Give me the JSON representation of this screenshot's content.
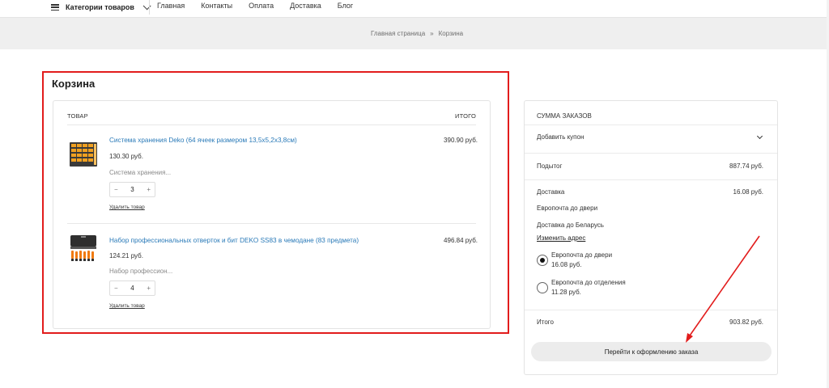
{
  "nav": {
    "categories_label": "Категории товаров",
    "links": [
      "Главная",
      "Контакты",
      "Оплата",
      "Доставка",
      "Блог"
    ]
  },
  "breadcrumb": {
    "home": "Главная страница",
    "separator": "»",
    "current": "Корзина"
  },
  "cart": {
    "title": "Корзина",
    "col_product": "ТОВАР",
    "col_total": "ИТОГО",
    "items": [
      {
        "name": "Система хранения Deko (64 ячеек размером 13,5х5,2х3,8см)",
        "price": "130.30 руб.",
        "subtitle": "Система хранения...",
        "qty": "3",
        "remove_label": "Удалить товар",
        "total": "390.90 руб."
      },
      {
        "name": "Набор профессиональных отверток и бит DEKO SS83 в чемодане (83 предмета)",
        "price": "124.21 руб.",
        "subtitle": "Набор профессион...",
        "qty": "4",
        "remove_label": "Удалить товар",
        "total": "496.84 руб."
      }
    ],
    "minus_symbol": "−",
    "plus_symbol": "+"
  },
  "totals": {
    "title": "СУММА ЗАКАЗОВ",
    "coupon_label": "Добавить купон",
    "subtotal_label": "Подытог",
    "subtotal_value": "887.74 руб.",
    "shipping_label": "Доставка",
    "shipping_value": "16.08 руб.",
    "shipping_method": "Европочта до двери",
    "shipping_destination": "Доставка до Беларусь",
    "change_address": "Изменить адрес",
    "options": [
      {
        "label": "Европочта до двери",
        "price": "16.08 руб.",
        "selected": true
      },
      {
        "label": "Европочта до отделения",
        "price": "11.28 руб.",
        "selected": false
      }
    ],
    "total_label": "Итого",
    "total_value": "903.82 руб.",
    "checkout_label": "Перейти к оформлению заказа"
  },
  "colors": {
    "highlight": "#e21c1c",
    "link": "#2a7ab8",
    "band": "#efefef"
  }
}
